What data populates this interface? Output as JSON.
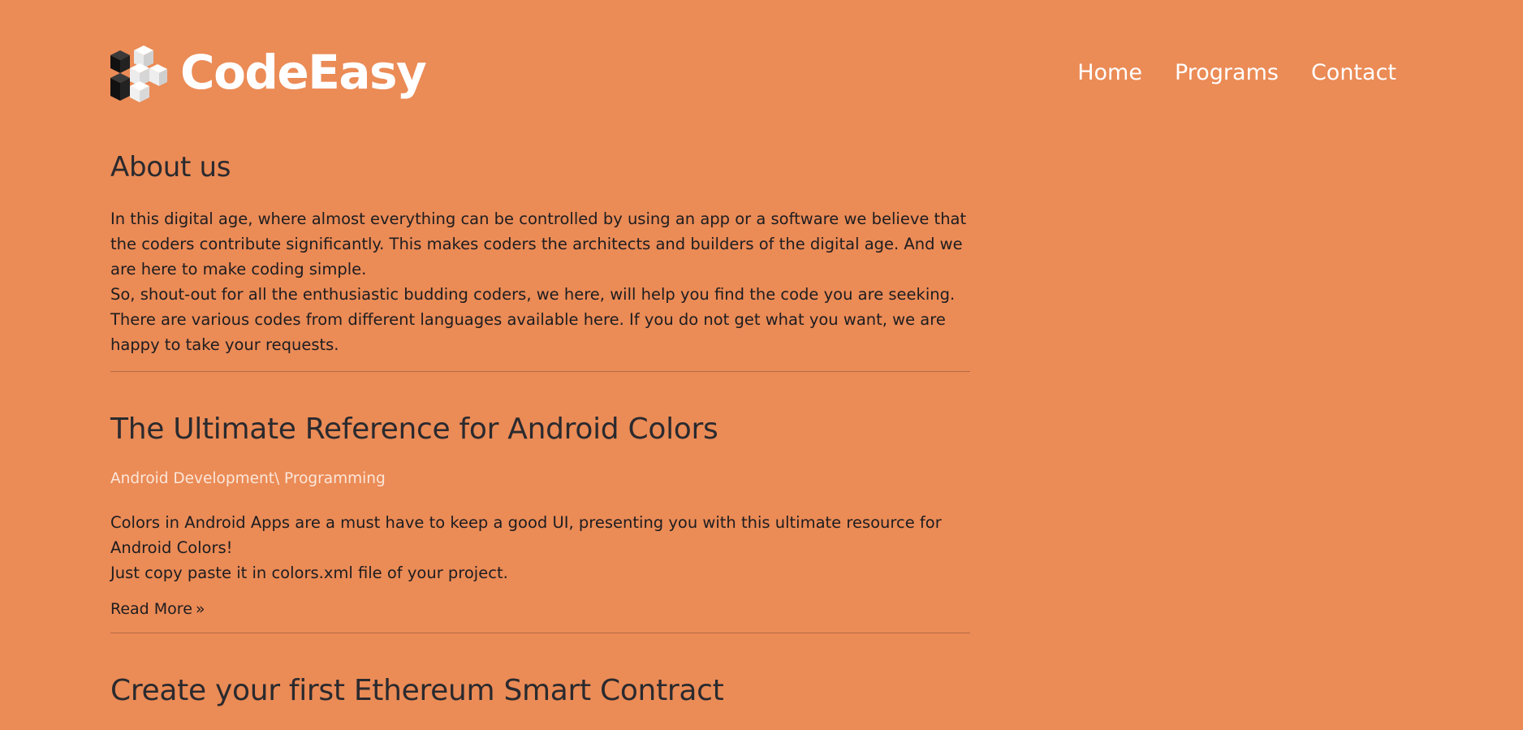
{
  "header": {
    "logo_text": "CodeEasy",
    "nav": [
      {
        "label": "Home"
      },
      {
        "label": "Programs"
      },
      {
        "label": "Contact"
      }
    ]
  },
  "about": {
    "title": "About us",
    "paragraph_1": "In this digital age, where almost everything can be controlled by using an app or a software we believe that the coders contribute significantly. This makes coders the architects and builders of the digital age. And we are here to make coding simple.",
    "paragraph_2": "So, shout-out for all the enthusiastic budding coders, we here, will help you find the code you are seeking. There are various codes from different languages available here. If you do not get what you want, we are happy to take your requests."
  },
  "posts": [
    {
      "title": "The Ultimate Reference for Android Colors",
      "categories": "Android Development\\ Programming",
      "excerpt_1": "Colors in Android Apps are a must have to keep a good UI, presenting you with this ultimate resource for Android Colors!",
      "excerpt_2": "Just copy paste it in colors.xml file of your project.",
      "read_more": "Read More",
      "read_more_icon": "double-chevron-right-icon"
    },
    {
      "title": "Create your first Ethereum Smart Contract"
    }
  ],
  "colors": {
    "background": "#eb8b56",
    "text": "#1f1f22",
    "nav_text": "#ffffff",
    "category_text": "#fbe7da"
  }
}
